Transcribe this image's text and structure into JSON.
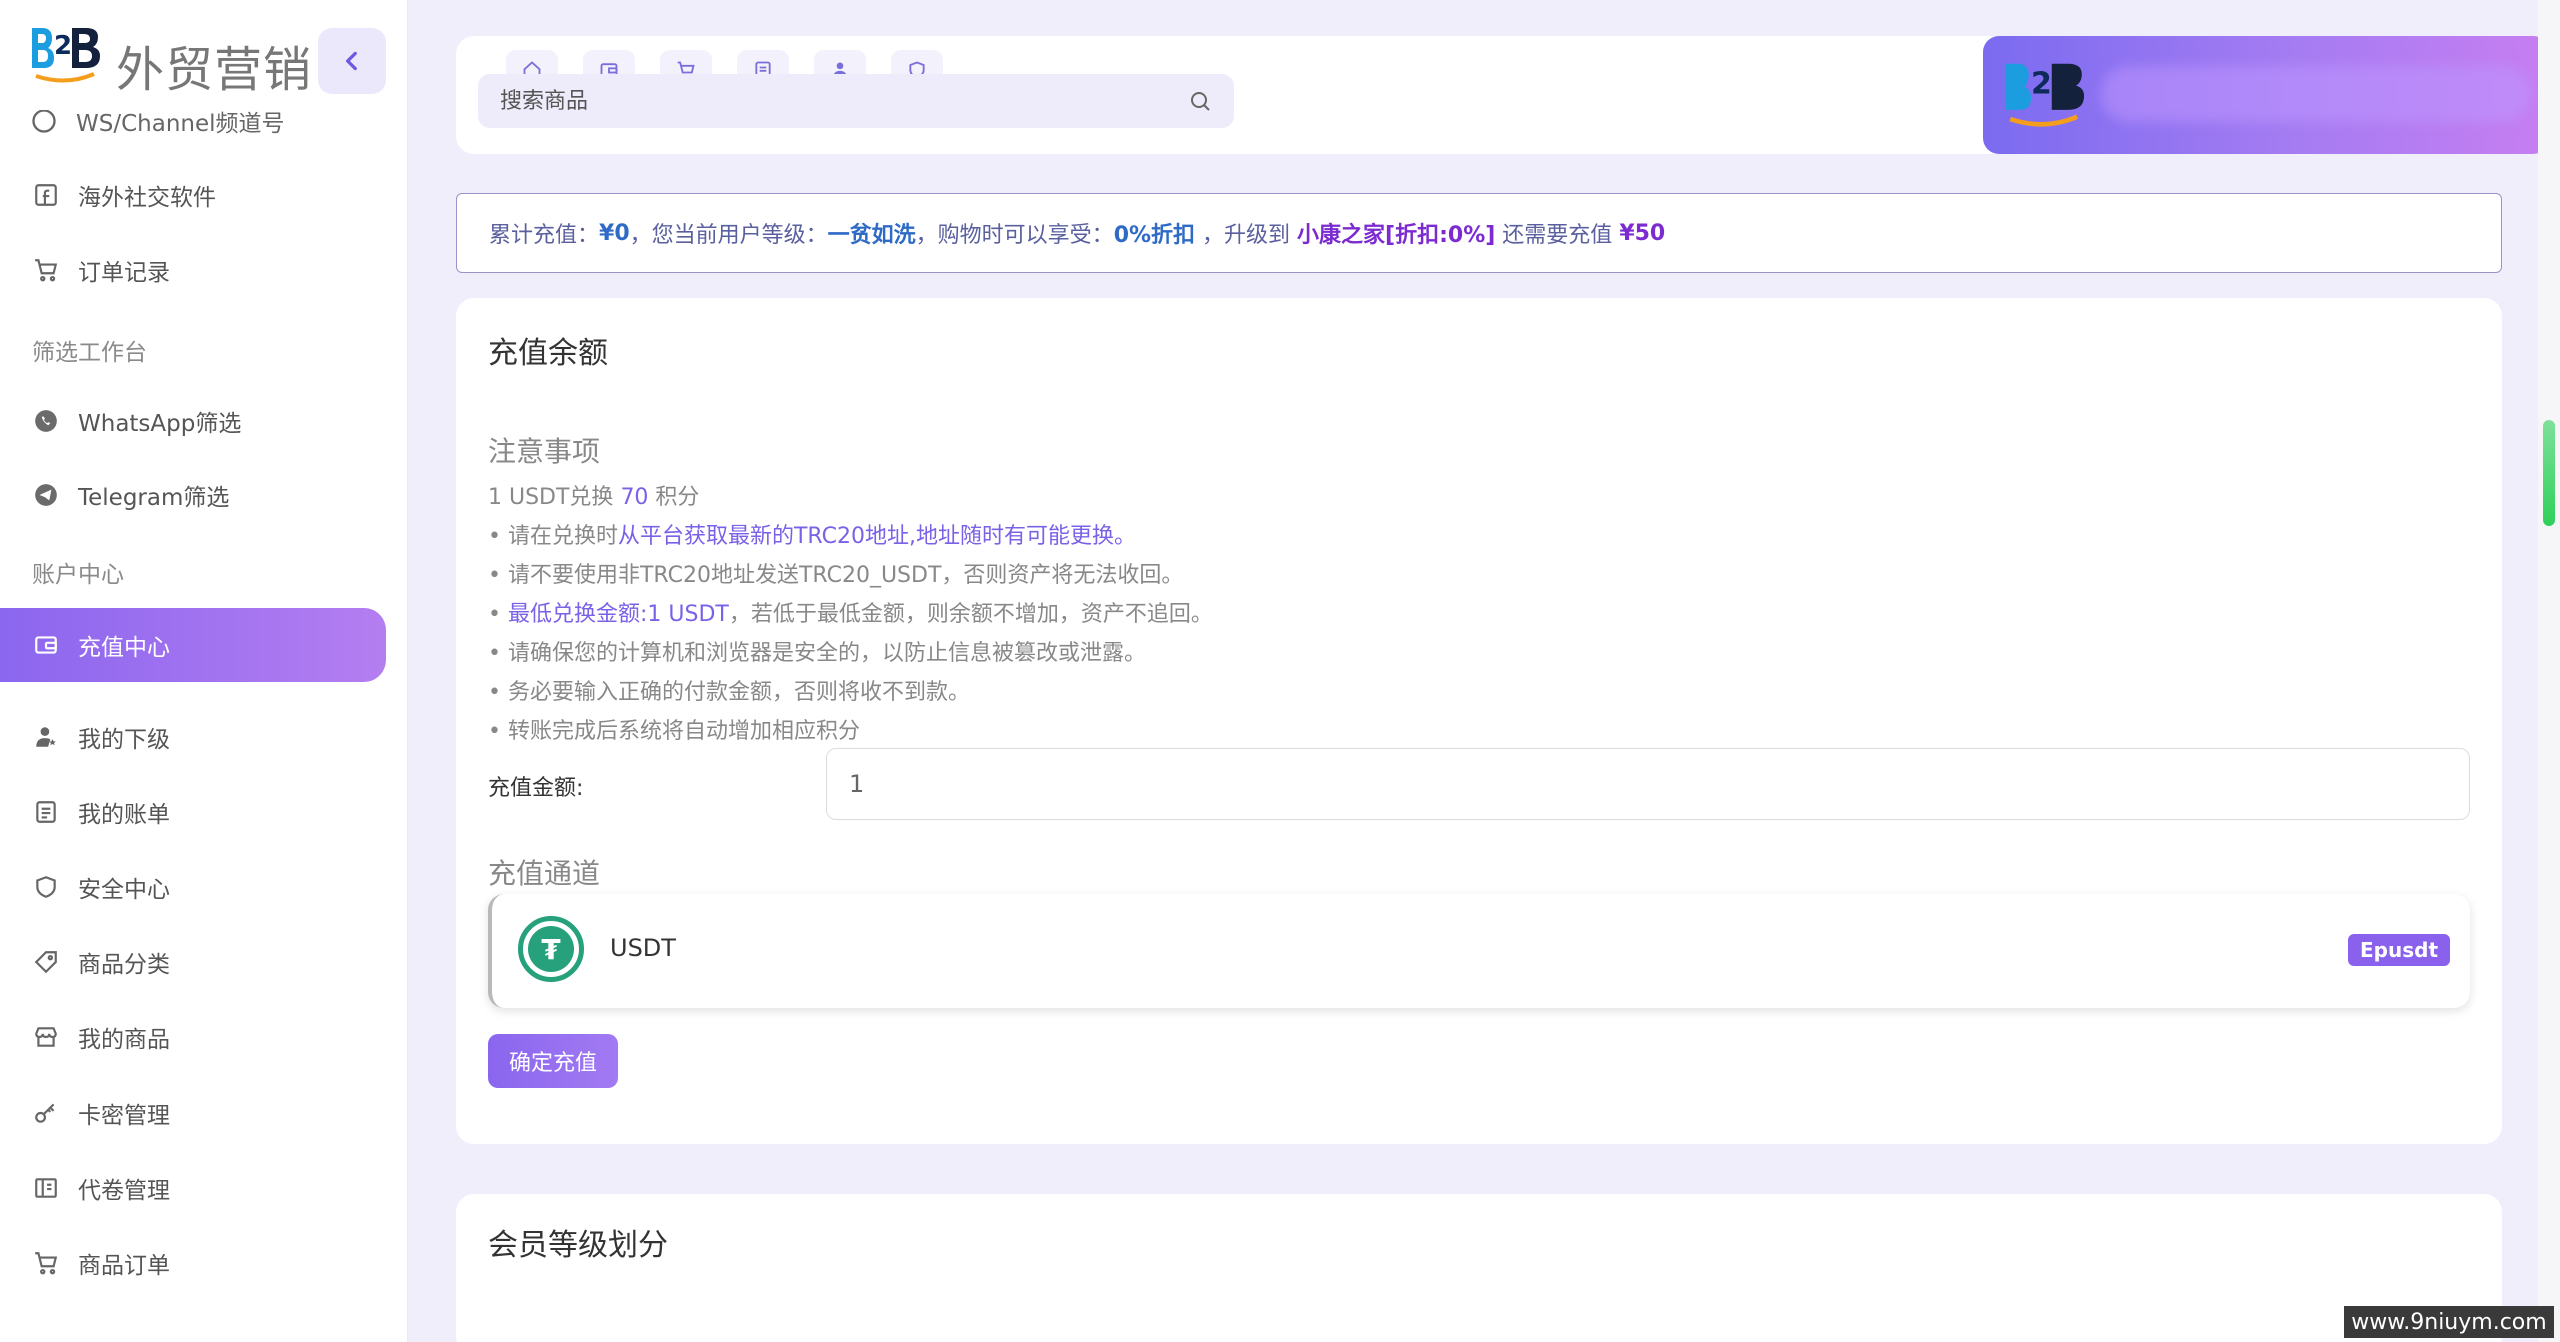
{
  "brand": {
    "name": "外贸营销"
  },
  "sidebar": {
    "clipped_item": "WS/Channel频道号",
    "items": [
      {
        "label": "海外社交软件",
        "icon": "facebook-icon"
      },
      {
        "label": "订单记录",
        "icon": "cart-icon"
      }
    ],
    "section_filter": "筛选工作台",
    "filter_items": [
      {
        "label": "WhatsApp筛选",
        "icon": "whatsapp-icon"
      },
      {
        "label": "Telegram筛选",
        "icon": "telegram-icon"
      }
    ],
    "section_account": "账户中心",
    "account_items": [
      {
        "label": "充值中心",
        "icon": "wallet-icon",
        "active": true
      },
      {
        "label": "我的下级",
        "icon": "user-star-icon"
      },
      {
        "label": "我的账单",
        "icon": "bill-icon"
      },
      {
        "label": "安全中心",
        "icon": "shield-icon"
      },
      {
        "label": "商品分类",
        "icon": "tag-icon"
      },
      {
        "label": "我的商品",
        "icon": "store-icon"
      },
      {
        "label": "卡密管理",
        "icon": "key-icon"
      },
      {
        "label": "代卷管理",
        "icon": "ticket-icon"
      },
      {
        "label": "商品订单",
        "icon": "cart-icon"
      }
    ]
  },
  "header": {
    "quick_tabs": [
      "home-icon",
      "wallet-icon",
      "cart-icon",
      "bill-icon",
      "user-star-icon",
      "shield-icon"
    ],
    "search_placeholder": "搜索商品"
  },
  "notice": {
    "p1": "累计充值：",
    "total": "¥0",
    "p2": "，您当前用户等级：",
    "level": "一贫如洗",
    "p3": "，购物时可以享受：",
    "discount": "0%折扣",
    "p4": " ，升级到 ",
    "next_level": "小康之家[折扣:0%]",
    "p5": " 还需要充值 ",
    "need": "¥50"
  },
  "recharge": {
    "title": "充值余额",
    "notes_title": "注意事项",
    "rate_prefix": "1 USDT兑换 ",
    "rate_value": "70",
    "rate_suffix": " 积分",
    "note1_prefix": "• 请在兑换时",
    "note1_accent": "从平台获取最新的TRC20地址,地址随时有可能更换。",
    "note2": "• 请不要使用非TRC20地址发送TRC20_USDT，否则资产将无法收回。",
    "note3_prefix": "• ",
    "note3_accent": "最低兑换金额:1 USDT",
    "note3_suffix": "，若低于最低金额，则余额不增加，资产不追回。",
    "note4": "• 请确保您的计算机和浏览器是安全的，以防止信息被篡改或泄露。",
    "note5": "• 务必要输入正确的付款金额，否则将收不到款。",
    "note6": "• 转账完成后系统将自动增加相应积分",
    "amount_label": "充值金额:",
    "amount_value": "1",
    "channel_title": "充值通道",
    "channel_name": "USDT",
    "channel_badge": "Epusdt",
    "confirm": "确定充值"
  },
  "member": {
    "title": "会员等级划分"
  },
  "watermark": "www.9niuym.com",
  "colors": {
    "accent": "#8b66ef",
    "tether": "#26a17b",
    "notice_blue": "#2f6bc6",
    "notice_purple": "#7c2bd0"
  }
}
